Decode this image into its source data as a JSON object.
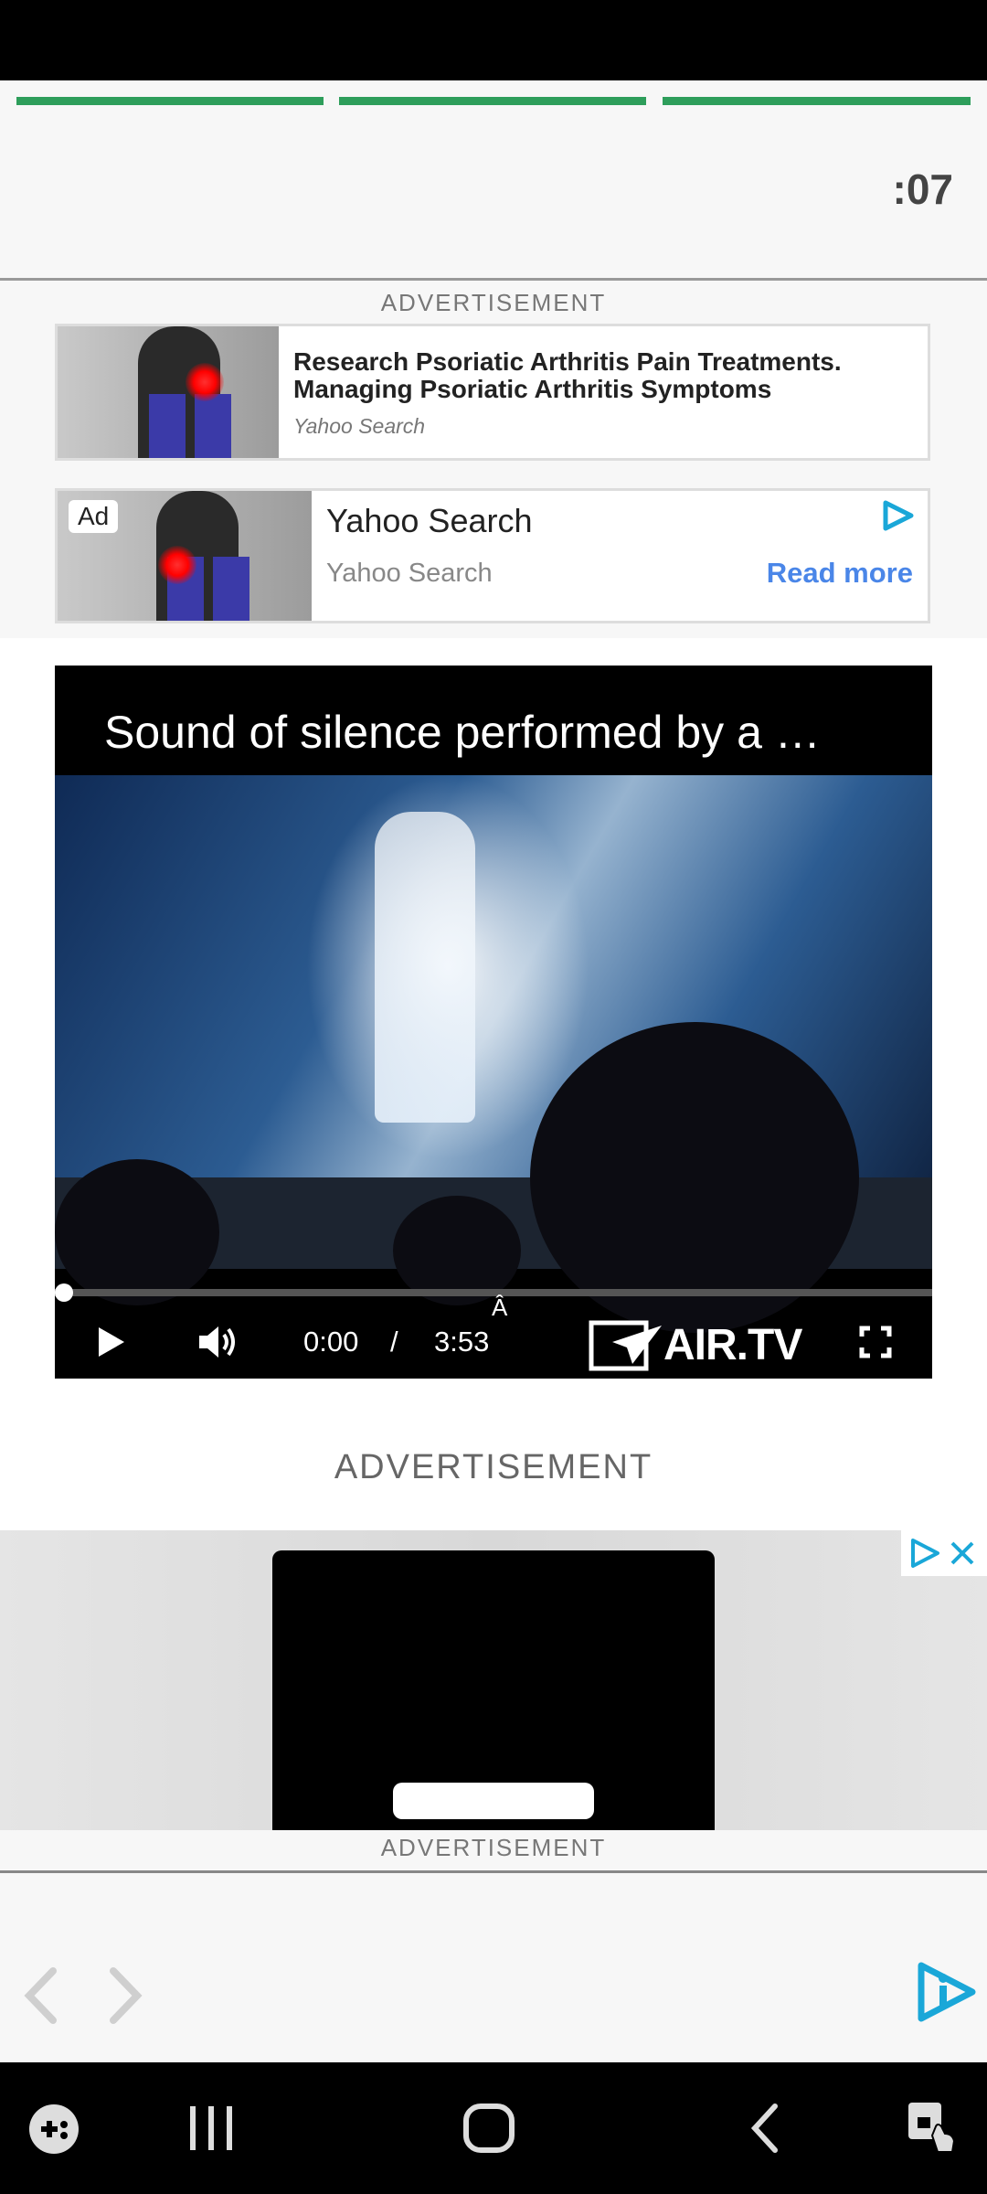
{
  "timer": ":07",
  "ad_label": "ADVERTISEMENT",
  "ad1": {
    "title": "Research Psoriatic Arthritis Pain Treatments. Managing Psoriatic Arthritis Symptoms",
    "source": "Yahoo Search"
  },
  "ad2": {
    "badge": "Ad",
    "title": "Yahoo Search",
    "source": "Yahoo Search",
    "cta": "Read more"
  },
  "video": {
    "title": "Sound of silence performed by a …",
    "current_time": "0:00",
    "separator": "/",
    "duration": "3:53",
    "stray_char": "Â",
    "brand": "AIR.TV",
    "progress": 0.0
  },
  "colors": {
    "progress_green": "#2e9e5b",
    "link_blue": "#4a86e8",
    "adchoices_cyan": "#1aa7d8"
  },
  "icons": {
    "play": "play-icon",
    "volume": "volume-icon",
    "fullscreen": "fullscreen-icon",
    "adchoices": "adchoices-icon",
    "close": "close-icon",
    "back": "chevron-left-icon",
    "forward": "chevron-right-icon"
  }
}
